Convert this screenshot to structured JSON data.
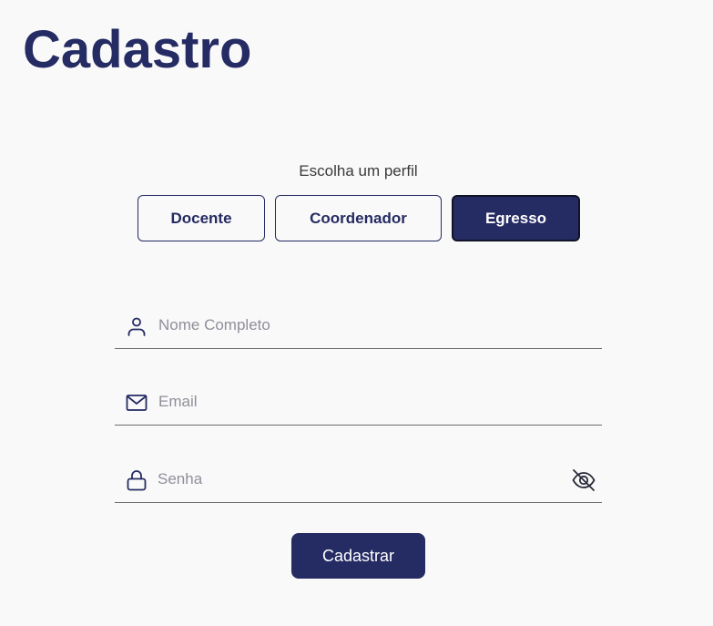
{
  "page": {
    "title": "Cadastro"
  },
  "profile": {
    "prompt": "Escolha um perfil",
    "options": [
      {
        "label": "Docente",
        "selected": false
      },
      {
        "label": "Coordenador",
        "selected": false
      },
      {
        "label": "Egresso",
        "selected": true
      }
    ]
  },
  "form": {
    "name": {
      "placeholder": "Nome Completo",
      "value": "",
      "icon": "user-icon"
    },
    "email": {
      "placeholder": "Email",
      "value": "",
      "icon": "mail-icon"
    },
    "password": {
      "placeholder": "Senha",
      "value": "",
      "icon": "lock-icon",
      "toggle_icon": "eye-off-icon"
    },
    "submit_label": "Cadastrar"
  },
  "colors": {
    "primary": "#252b63",
    "background": "#f9f9f9",
    "placeholder": "#8f8f9a"
  }
}
